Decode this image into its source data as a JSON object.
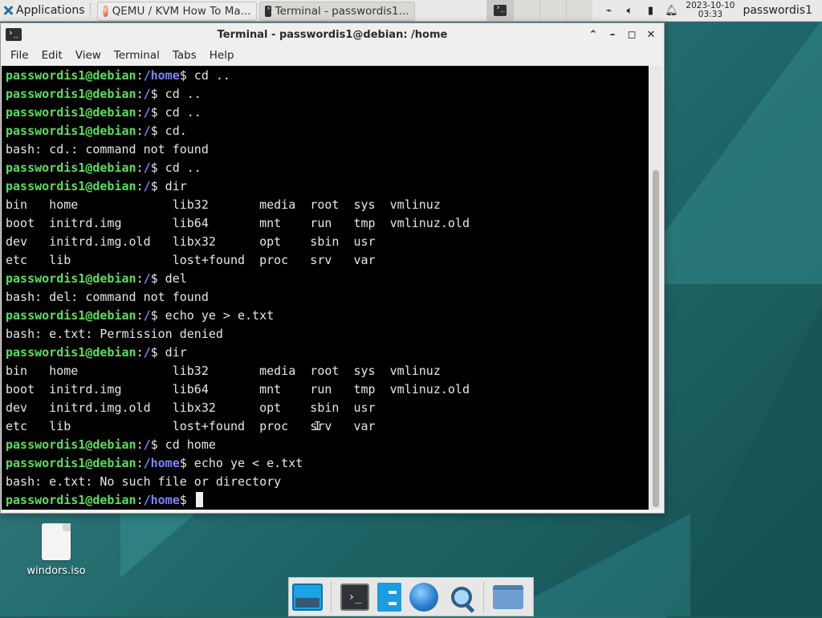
{
  "panel": {
    "apps_label": "Applications",
    "tasks": [
      {
        "label": "QEMU / KVM How To Ma...",
        "icon": "firefox-icon"
      },
      {
        "label": "Terminal - passwordis1...",
        "icon": "terminal-icon"
      }
    ],
    "clock_date": "2023-10-10",
    "clock_time": "03:33",
    "username": "passwordis1"
  },
  "window": {
    "title": "Terminal - passwordis1@debian: /home",
    "menu": [
      "File",
      "Edit",
      "View",
      "Terminal",
      "Tabs",
      "Help"
    ]
  },
  "terminal": {
    "lines": [
      {
        "user": "passwordis1@debian",
        "path": "/home",
        "cmd": "$ cd .."
      },
      {
        "user": "passwordis1@debian",
        "path": "/",
        "cmd": "$ cd .."
      },
      {
        "user": "passwordis1@debian",
        "path": "/",
        "cmd": "$ cd .."
      },
      {
        "user": "passwordis1@debian",
        "path": "/",
        "cmd": "$ cd."
      },
      {
        "text": "bash: cd.: command not found"
      },
      {
        "user": "passwordis1@debian",
        "path": "/",
        "cmd": "$ cd .."
      },
      {
        "user": "passwordis1@debian",
        "path": "/",
        "cmd": "$ dir"
      },
      {
        "text": "bin   home             lib32       media  root  sys  vmlinuz"
      },
      {
        "text": "boot  initrd.img       lib64       mnt    run   tmp  vmlinuz.old"
      },
      {
        "text": "dev   initrd.img.old   libx32      opt    sbin  usr"
      },
      {
        "text": "etc   lib              lost+found  proc   srv   var"
      },
      {
        "user": "passwordis1@debian",
        "path": "/",
        "cmd": "$ del"
      },
      {
        "text": "bash: del: command not found"
      },
      {
        "user": "passwordis1@debian",
        "path": "/",
        "cmd": "$ echo ye > e.txt"
      },
      {
        "text": "bash: e.txt: Permission denied"
      },
      {
        "user": "passwordis1@debian",
        "path": "/",
        "cmd": "$ dir"
      },
      {
        "text": "bin   home             lib32       media  root  sys  vmlinuz"
      },
      {
        "text": "boot  initrd.img       lib64       mnt    run   tmp  vmlinuz.old"
      },
      {
        "text": "dev   initrd.img.old   libx32      opt    sbin  usr"
      },
      {
        "text": "etc   lib              lost+found  proc   srv   var"
      },
      {
        "user": "passwordis1@debian",
        "path": "/",
        "cmd": "$ cd home"
      },
      {
        "user": "passwordis1@debian",
        "path": "/home",
        "cmd": "$ echo ye < e.txt"
      },
      {
        "text": "bash: e.txt: No such file or directory"
      },
      {
        "user": "passwordis1@debian",
        "path": "/home",
        "cmd": "$ ",
        "cursor": true
      }
    ]
  },
  "desktop": {
    "icons": [
      {
        "label": "windors.iso"
      }
    ]
  },
  "colors": {
    "prompt_user": "#59e05a",
    "prompt_path": "#7a83ff",
    "terminal_bg": "#000000"
  }
}
